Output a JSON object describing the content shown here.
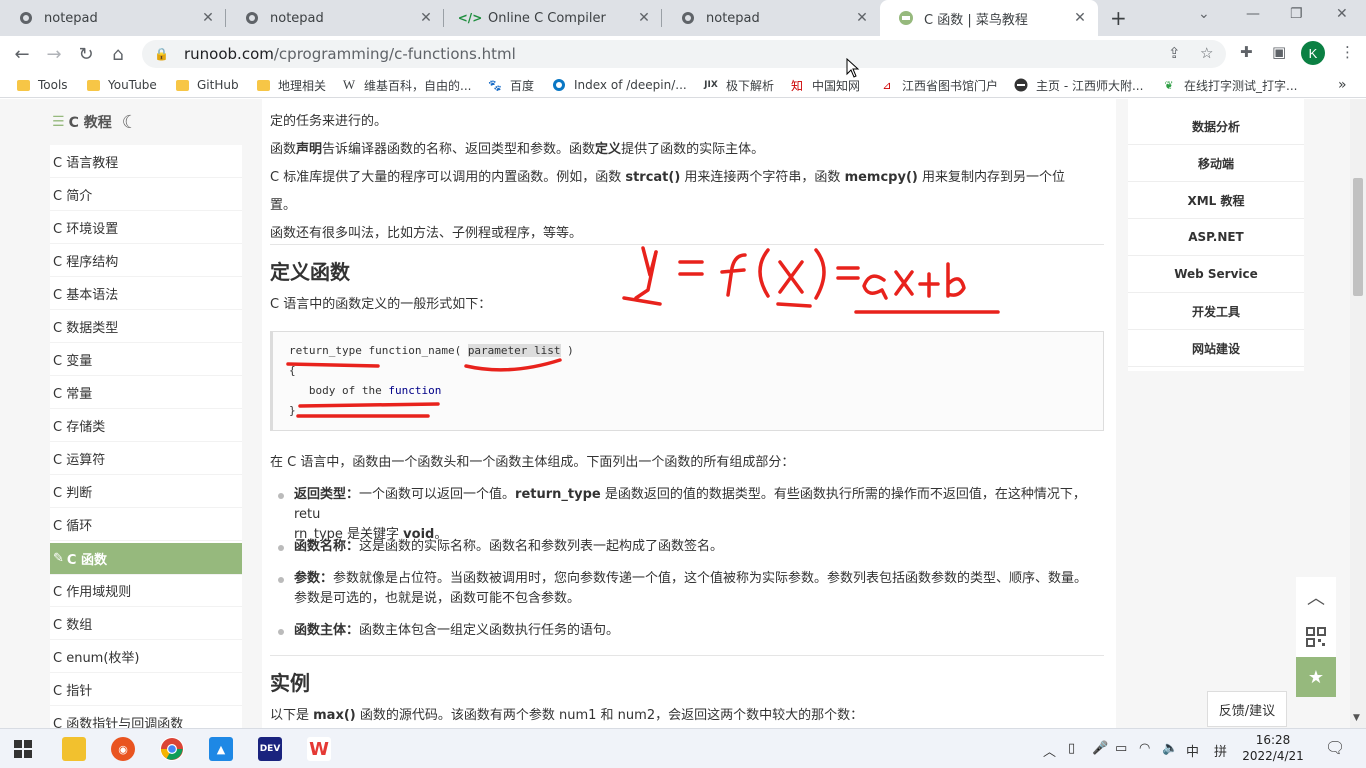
{
  "tabs": [
    {
      "title": "notepad",
      "icon": "globe-icon"
    },
    {
      "title": "notepad",
      "icon": "globe-icon"
    },
    {
      "title": "Online C Compiler",
      "icon": "code-icon"
    },
    {
      "title": "notepad",
      "icon": "globe-icon"
    },
    {
      "title": "C 函数 | 菜鸟教程",
      "icon": "runoob-icon",
      "active": true
    }
  ],
  "address": {
    "host": "runoob.com",
    "path": "/cprogramming/c-functions.html"
  },
  "profile_initial": "K",
  "bookmarks": [
    "Tools",
    "YouTube",
    "GitHub",
    "地理相关",
    "维基百科，自由的...",
    "百度",
    "Index of /deepin/...",
    "极下解析",
    "中国知网",
    "江西省图书馆门户",
    "主页 - 江西师大附...",
    "在线打字测试_打字..."
  ],
  "sidebar": {
    "title": "C 教程",
    "items": [
      "C 语言教程",
      "C 简介",
      "C 环境设置",
      "C 程序结构",
      "C 基本语法",
      "C 数据类型",
      "C 变量",
      "C 常量",
      "C 存储类",
      "C 运算符",
      "C 判断",
      "C 循环",
      "C 函数",
      "C 作用域规则",
      "C 数组",
      "C enum(枚举)",
      "C 指针",
      "C 函数指针与回调函数"
    ],
    "active": "C 函数"
  },
  "content": {
    "p1": "定的任务来进行的。",
    "p2a": "函数",
    "p2b": "声明",
    "p2c": "告诉编译器函数的名称、返回类型和参数。函数",
    "p2d": "定义",
    "p2e": "提供了函数的实际主体。",
    "p3a": "C 标准库提供了大量的程序可以调用的内置函数。例如，函数 ",
    "p3b": "strcat()",
    "p3c": " 用来连接两个字符串，函数 ",
    "p3d": "memcpy()",
    "p3e": " 用来复制内存到另一个位",
    "p3f": "置。",
    "p4": "函数还有很多叫法，比如方法、子例程或程序，等等。",
    "h_define": "定义函数",
    "p5": "C 语言中的函数定义的一般形式如下：",
    "code": {
      "l1a": "return_type function_name( ",
      "l1b": "parameter list",
      "l1c": " )",
      "l2": "{",
      "l3a": "   body of the ",
      "l3b": "function",
      "l4": "}"
    },
    "p6": "在 C 语言中，函数由一个函数头和一个函数主体组成。下面列出一个函数的所有组成部分：",
    "li1a": "返回类型：",
    "li1b": "一个函数可以返回一个值。",
    "li1c": "return_type",
    "li1d": " 是函数返回的值的数据类型。有些函数执行所需的操作而不返回值，在这种情况下，retu",
    "li1e": "rn_type 是关键字 ",
    "li1f": "void",
    "li2a": "函数名称：",
    "li2b": "这是函数的实际名称。函数名和参数列表一起构成了函数签名。",
    "li3a": "参数：",
    "li3b": "参数就像是占位符。当函数被调用时，您向参数传递一个值，这个值被称为实际参数。参数列表包括函数参数的类型、顺序、数量。",
    "li3c": "参数是可选的，也就是说，函数可能不包含参数。",
    "li4a": "函数主体：",
    "li4b": "函数主体包含一组定义函数执行任务的语句。",
    "h_example": "实例",
    "p7a": "以下是 ",
    "p7b": "max()",
    "p7c": " 函数的源代码。该函数有两个参数 num1 和 num2，会返回这两个数中较大的那个数："
  },
  "right_menu": [
    "数据分析",
    "移动端",
    "XML 教程",
    "ASP.NET",
    "Web Service",
    "开发工具",
    "网站建设"
  ],
  "feedback": "反馈/建议",
  "taskbar": {
    "ime1": "中",
    "ime2": "拼",
    "time": "16:28",
    "date": "2022/4/21"
  }
}
